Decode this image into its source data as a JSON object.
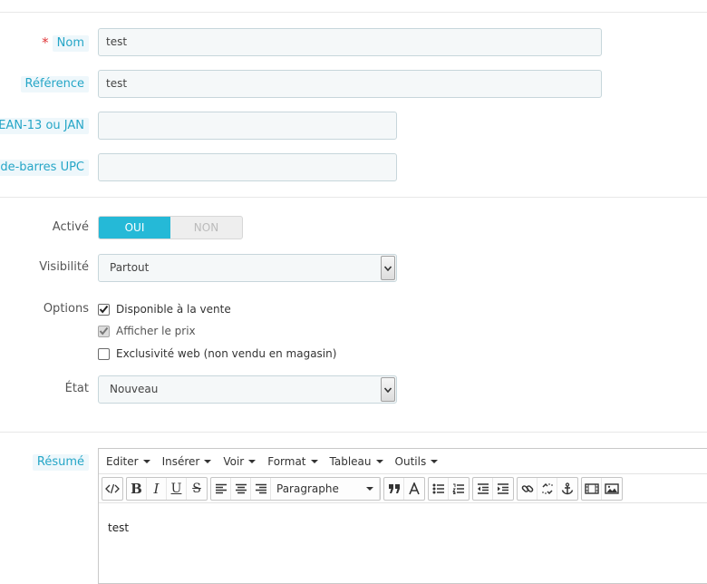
{
  "product": {
    "name_label": "Nom",
    "name_required_mark": "*",
    "name_value": "test",
    "reference_label": "Référence",
    "reference_value": "test",
    "ean_label": "EAN-13 ou JAN",
    "ean_value": "",
    "upc_label": "ode-barres UPC",
    "upc_value": ""
  },
  "status": {
    "active_label": "Activé",
    "on_label": "OUI",
    "off_label": "NON",
    "active_selected": "OUI"
  },
  "visibility": {
    "label": "Visibilité",
    "selected": "Partout"
  },
  "options": {
    "label": "Options",
    "items": [
      {
        "label": "Disponible à la vente",
        "checked": true
      },
      {
        "label": "Afficher le prix",
        "checked": true
      },
      {
        "label": "Exclusivité web (non vendu en magasin)",
        "checked": false
      }
    ]
  },
  "condition": {
    "label": "État",
    "selected": "Nouveau"
  },
  "summary": {
    "label": "Résumé",
    "menu": [
      "Editer",
      "Insérer",
      "Voir",
      "Format",
      "Tableau",
      "Outils"
    ],
    "format_select": "Paragraphe",
    "content": "test"
  },
  "colors": {
    "accent": "#25b9d7",
    "hint_text": "#25a6c7",
    "required": "#e0373a"
  }
}
